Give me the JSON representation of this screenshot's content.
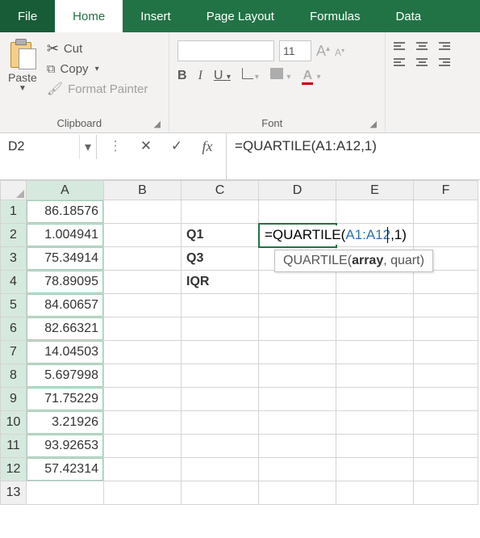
{
  "tabs": {
    "file": "File",
    "home": "Home",
    "insert": "Insert",
    "page_layout": "Page Layout",
    "formulas": "Formulas",
    "data": "Data"
  },
  "ribbon": {
    "clipboard": {
      "paste": "Paste",
      "cut": "Cut",
      "copy": "Copy",
      "format_painter": "Format Painter",
      "group_label": "Clipboard"
    },
    "font": {
      "size": "11",
      "group_label": "Font"
    }
  },
  "name_box": "D2",
  "formula_bar": "=QUARTILE(A1:A12,1)",
  "columns": [
    "A",
    "B",
    "C",
    "D",
    "E",
    "F"
  ],
  "rows": [
    "1",
    "2",
    "3",
    "4",
    "5",
    "6",
    "7",
    "8",
    "9",
    "10",
    "11",
    "12",
    "13"
  ],
  "cells": {
    "A1": "86.18576",
    "A2": "1.004941",
    "A3": "75.34914",
    "A4": "78.89095",
    "A5": "84.60657",
    "A6": "82.66321",
    "A7": "14.04503",
    "A8": "5.697998",
    "A9": "71.75229",
    "A10": "3.21926",
    "A11": "93.92653",
    "A12": "57.42314",
    "C2": "Q1",
    "C3": "Q3",
    "C4": "IQR"
  },
  "inline_edit": {
    "pre": "=QUARTILE(",
    "ref": "A1:A12",
    "post": ",1)"
  },
  "tooltip": {
    "fn": "QUARTILE(",
    "arg1": "array",
    "rest": ", quart)"
  },
  "chart_data": {
    "type": "table",
    "title": "Excel worksheet with QUARTILE formula entry",
    "columns": [
      "A",
      "B",
      "C",
      "D"
    ],
    "rows": [
      {
        "A": 86.18576,
        "C": "",
        "D": ""
      },
      {
        "A": 1.004941,
        "C": "Q1",
        "D": "=QUARTILE(A1:A12,1)"
      },
      {
        "A": 75.34914,
        "C": "Q3",
        "D": ""
      },
      {
        "A": 78.89095,
        "C": "IQR",
        "D": ""
      },
      {
        "A": 84.60657
      },
      {
        "A": 82.66321
      },
      {
        "A": 14.04503
      },
      {
        "A": 5.697998
      },
      {
        "A": 71.75229
      },
      {
        "A": 3.21926
      },
      {
        "A": 93.92653
      },
      {
        "A": 57.42314
      }
    ],
    "data_series": [
      86.18576,
      1.004941,
      75.34914,
      78.89095,
      84.60657,
      82.66321,
      14.04503,
      5.697998,
      71.75229,
      3.21926,
      93.92653,
      57.42314
    ]
  }
}
